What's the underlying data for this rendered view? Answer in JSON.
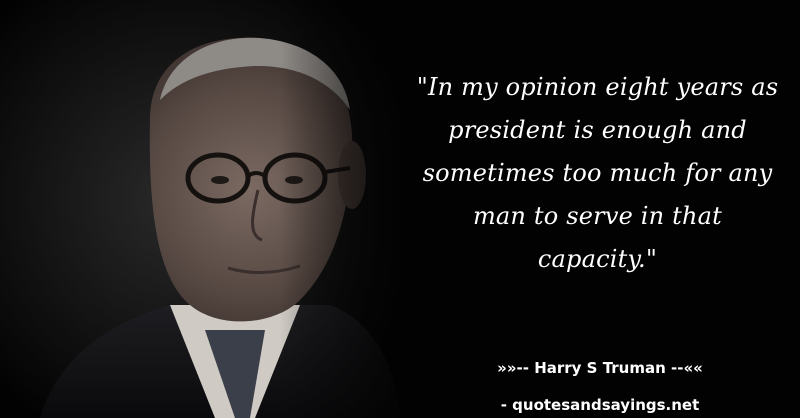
{
  "quote": {
    "text": "\"In my opinion eight years as president is enough and sometimes too much for any man to serve in that capacity.\""
  },
  "attribution": {
    "author_line": "»»-- Harry S Truman --««",
    "site": "- quotesandsayings.net"
  },
  "colors": {
    "background": "#020202",
    "text": "#ffffff"
  }
}
